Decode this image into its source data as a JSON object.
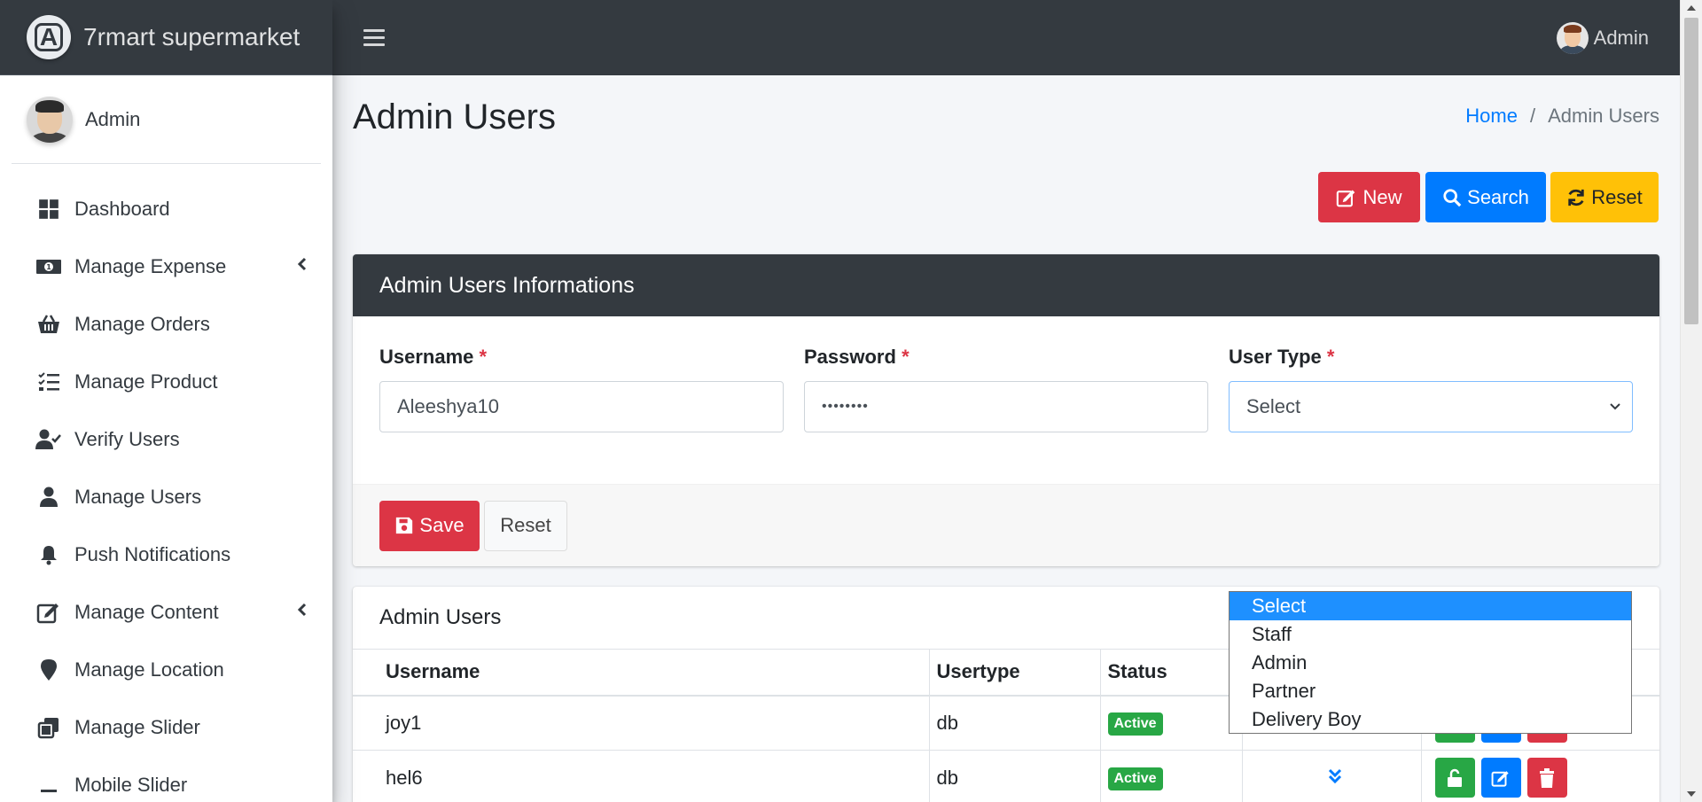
{
  "brand": {
    "name": "7rmart supermarket"
  },
  "topbar": {
    "user_name": "Admin"
  },
  "sidebar": {
    "user_name": "Admin",
    "items": [
      {
        "label": "Dashboard",
        "icon": "dashboard-icon",
        "has_submenu": false
      },
      {
        "label": "Manage Expense",
        "icon": "money-icon",
        "has_submenu": true
      },
      {
        "label": "Manage Orders",
        "icon": "basket-icon",
        "has_submenu": false
      },
      {
        "label": "Manage Product",
        "icon": "tasks-icon",
        "has_submenu": false
      },
      {
        "label": "Verify Users",
        "icon": "user-check-icon",
        "has_submenu": false
      },
      {
        "label": "Manage Users",
        "icon": "user-icon",
        "has_submenu": false
      },
      {
        "label": "Push Notifications",
        "icon": "bell-icon",
        "has_submenu": false
      },
      {
        "label": "Manage Content",
        "icon": "edit-icon",
        "has_submenu": true
      },
      {
        "label": "Manage Location",
        "icon": "map-marker-icon",
        "has_submenu": false
      },
      {
        "label": "Manage Slider",
        "icon": "clone-icon",
        "has_submenu": false
      },
      {
        "label": "Mobile Slider",
        "icon": "minus-icon",
        "has_submenu": false
      }
    ]
  },
  "page": {
    "title": "Admin Users",
    "breadcrumb": {
      "home": "Home",
      "separator": "/",
      "current": "Admin Users"
    },
    "toolbar": {
      "new_label": "New",
      "search_label": "Search",
      "reset_label": "Reset"
    }
  },
  "form": {
    "header": "Admin Users Informations",
    "username": {
      "label": "Username",
      "required": "*",
      "value": "Aleeshya10"
    },
    "password": {
      "label": "Password",
      "required": "*",
      "value": "••••••••"
    },
    "user_type": {
      "label": "User Type",
      "required": "*",
      "value": "Select",
      "options": [
        "Select",
        "Staff",
        "Admin",
        "Partner",
        "Delivery Boy"
      ]
    },
    "save_label": "Save",
    "reset_label": "Reset"
  },
  "table": {
    "title": "Admin Users",
    "columns": [
      "Username",
      "Usertype",
      "Status"
    ],
    "rows": [
      {
        "username": "joy1",
        "usertype": "db",
        "status": "Active"
      },
      {
        "username": "hel6",
        "usertype": "db",
        "status": "Active"
      }
    ]
  },
  "colors": {
    "danger": "#dc3545",
    "primary": "#007bff",
    "warning": "#ffc107",
    "success": "#28a745",
    "dark": "#343a40"
  }
}
